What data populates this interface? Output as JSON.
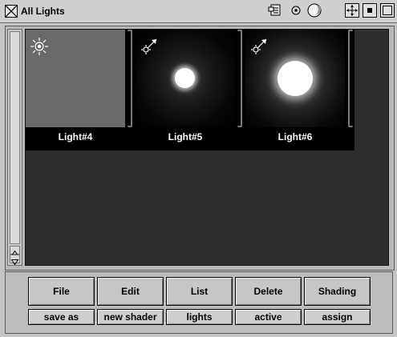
{
  "window": {
    "title": "All Lights"
  },
  "thumbnails": [
    {
      "label": "Light#4",
      "kind": "ambient",
      "icon": "sun-light-icon",
      "preview_color": "#6a6a6a",
      "light_size": 0
    },
    {
      "label": "Light#5",
      "kind": "point",
      "icon": "point-light-icon",
      "preview_color": "#000000",
      "light_size": 0.19
    },
    {
      "label": "Light#6",
      "kind": "point",
      "icon": "point-light-icon",
      "preview_color": "#000000",
      "light_size": 0.35
    }
  ],
  "buttons": {
    "main": [
      {
        "label": "File"
      },
      {
        "label": "Edit"
      },
      {
        "label": "List"
      },
      {
        "label": "Delete"
      },
      {
        "label": "Shading"
      }
    ],
    "sub": [
      {
        "label": "save as"
      },
      {
        "label": "new shader"
      },
      {
        "label": "lights"
      },
      {
        "label": "active"
      },
      {
        "label": "assign"
      }
    ]
  },
  "colors": {
    "view_background": "#2e2e2e",
    "window_background": "#c4c4c4",
    "light_glow": "#ffffff"
  }
}
